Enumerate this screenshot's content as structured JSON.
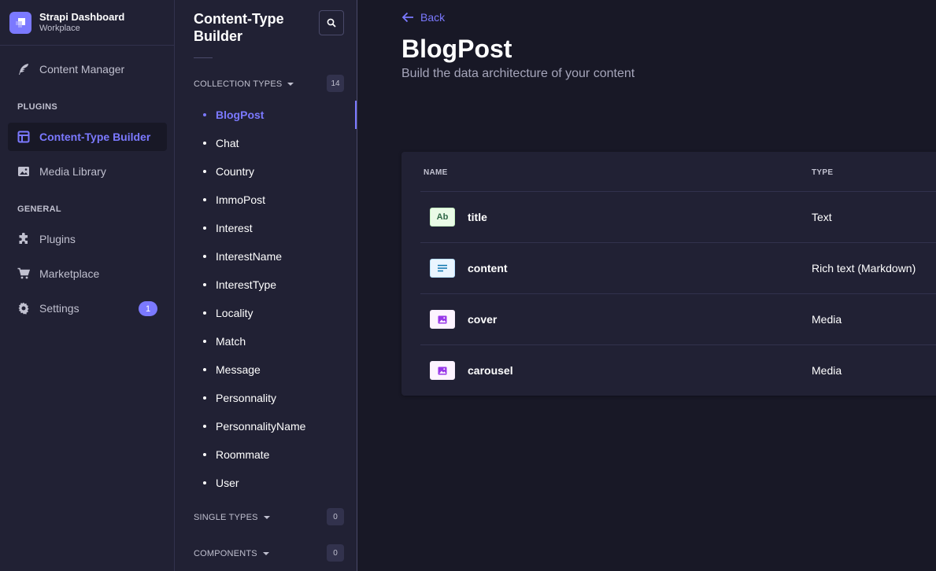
{
  "brand": {
    "title": "Strapi Dashboard",
    "subtitle": "Workplace",
    "icon": "strapi-logo-icon"
  },
  "mainnav": {
    "content_manager": "Content Manager",
    "plugins_section": "PLUGINS",
    "content_type_builder": "Content-Type Builder",
    "media_library": "Media Library",
    "general_section": "GENERAL",
    "plugins": "Plugins",
    "marketplace": "Marketplace",
    "settings": "Settings",
    "settings_badge": "1"
  },
  "subnav": {
    "title": "Content-Type Builder",
    "collection_types": {
      "label": "COLLECTION TYPES",
      "count": "14"
    },
    "items": [
      "BlogPost",
      "Chat",
      "Country",
      "ImmoPost",
      "Interest",
      "InterestName",
      "InterestType",
      "Locality",
      "Match",
      "Message",
      "Personnality",
      "PersonnalityName",
      "Roommate",
      "User"
    ],
    "active_item": "BlogPost",
    "single_types": {
      "label": "SINGLE TYPES",
      "count": "0"
    },
    "components": {
      "label": "COMPONENTS",
      "count": "0"
    }
  },
  "main": {
    "back": "Back",
    "title": "BlogPost",
    "subtitle": "Build the data architecture of your content",
    "table": {
      "col_name": "NAME",
      "col_type": "TYPE",
      "rows": [
        {
          "icon": "text-icon",
          "icon_label": "Ab",
          "name": "title",
          "type": "Text"
        },
        {
          "icon": "richtext-icon",
          "icon_label": "",
          "name": "content",
          "type": "Rich text (Markdown)"
        },
        {
          "icon": "media-icon",
          "icon_label": "",
          "name": "cover",
          "type": "Media"
        },
        {
          "icon": "media-icon",
          "icon_label": "",
          "name": "carousel",
          "type": "Media"
        }
      ]
    }
  },
  "colors": {
    "accent": "#7b79ff",
    "background": "#181826",
    "panel": "#212134",
    "text_icon_bg": "#eafbe7",
    "text_icon_fg": "#2f6846",
    "richtext_icon_bg": "#eaf5ff",
    "richtext_icon_fg": "#0c75af",
    "media_icon_bg": "#fdf4ff",
    "media_icon_fg": "#9736e8"
  }
}
